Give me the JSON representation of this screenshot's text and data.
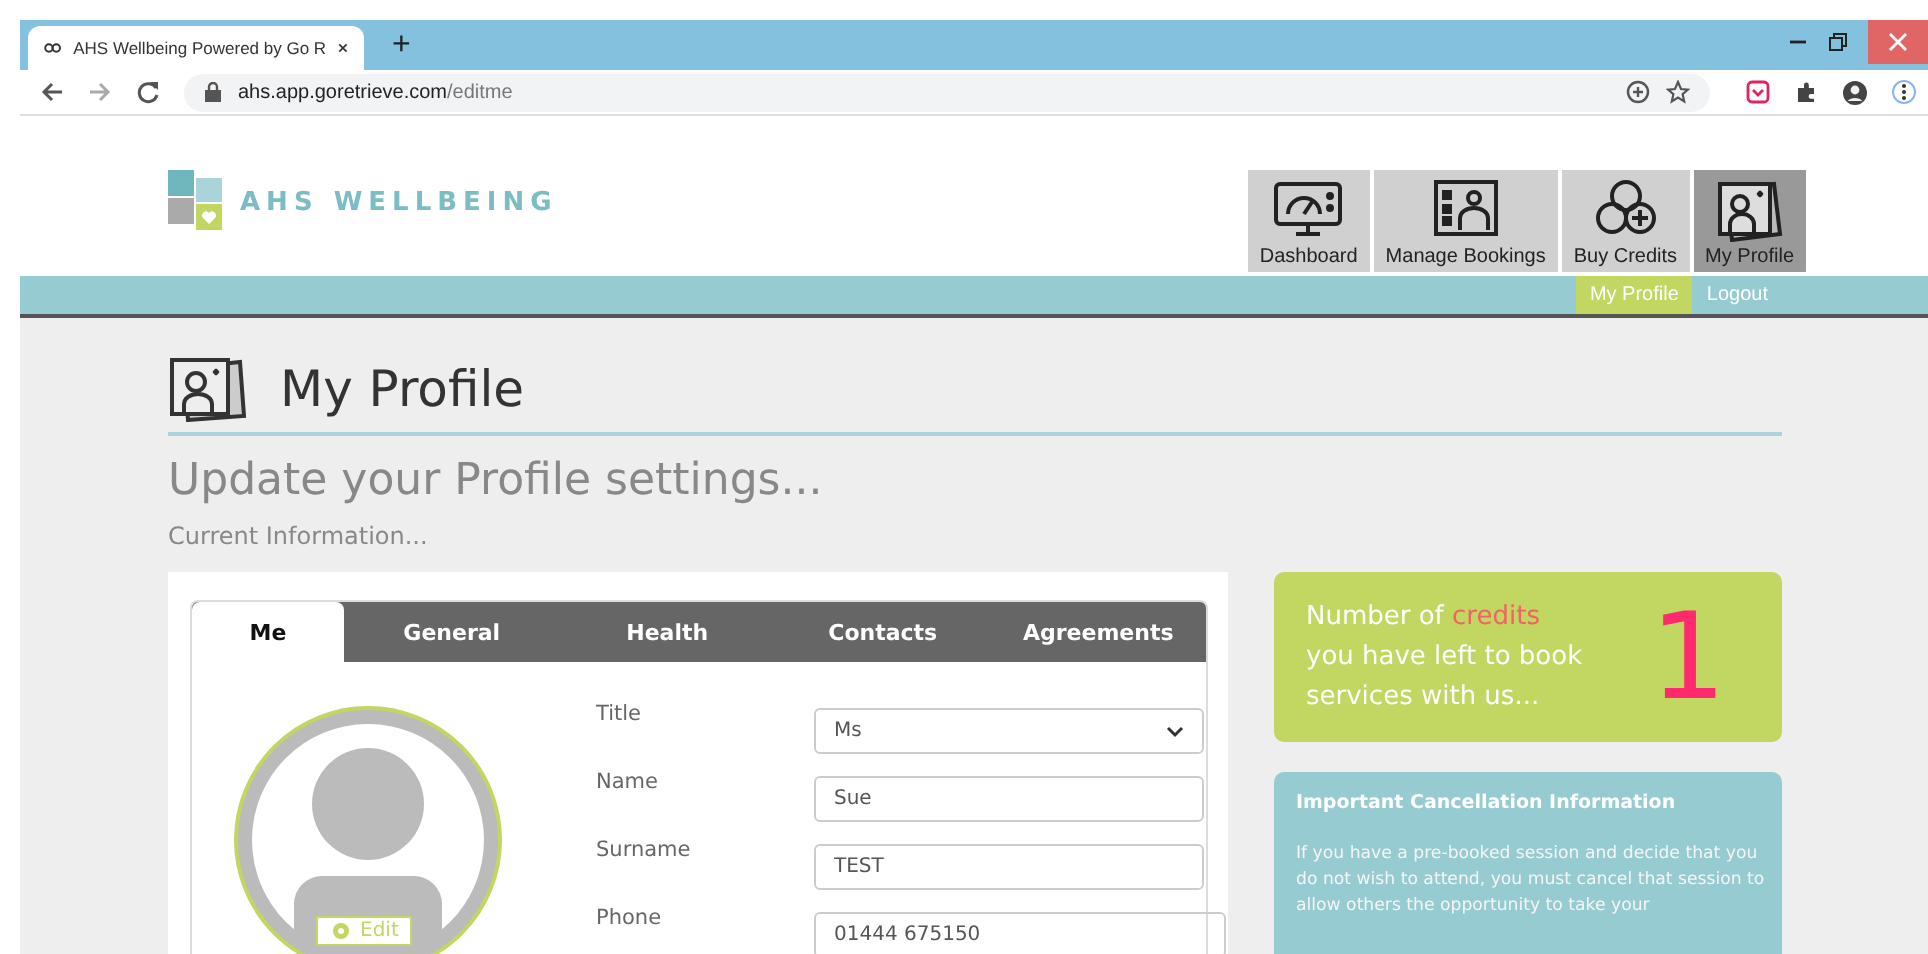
{
  "browser": {
    "tab_title": "AHS Wellbeing Powered by Go R",
    "new_tab": "+",
    "url_host": "ahs.app.goretrieve.com",
    "url_path": "/editme"
  },
  "logo": {
    "text": "AHS WELLBEING"
  },
  "nav": [
    {
      "label": "Dashboard",
      "kind": "dashboard",
      "selected": false
    },
    {
      "label": "Manage Bookings",
      "kind": "bookings",
      "selected": false
    },
    {
      "label": "Buy Credits",
      "kind": "credits",
      "selected": false
    },
    {
      "label": "My Profile",
      "kind": "profile",
      "selected": true
    }
  ],
  "subnav": [
    {
      "label": "My Profile",
      "selected": true
    },
    {
      "label": "Logout",
      "selected": false
    }
  ],
  "page": {
    "title": "My Profile",
    "subtitle": "Update your Profile settings...",
    "caption": "Current Information..."
  },
  "tabs": [
    {
      "label": "Me",
      "selected": true
    },
    {
      "label": "General",
      "selected": false
    },
    {
      "label": "Health",
      "selected": false
    },
    {
      "label": "Contacts",
      "selected": false
    },
    {
      "label": "Agreements",
      "selected": false
    }
  ],
  "avatar": {
    "edit_label": "Edit"
  },
  "fields": [
    {
      "label": "Title",
      "kind": "select",
      "value": "Ms"
    },
    {
      "label": "Name",
      "kind": "text",
      "value": "Sue"
    },
    {
      "label": "Surname",
      "kind": "text",
      "value": "TEST"
    },
    {
      "label": "Phone",
      "kind": "text",
      "value": "01444 675150"
    }
  ],
  "credits": {
    "lead": "Number of",
    "word": "credits",
    "rest": "you have left to book services with us...",
    "count": "1"
  },
  "cancellation": {
    "title": "Important Cancellation Information",
    "text": "If you have a pre-booked session and decide that you do not wish to attend, you must cancel that session to allow others the opportunity to take your"
  }
}
